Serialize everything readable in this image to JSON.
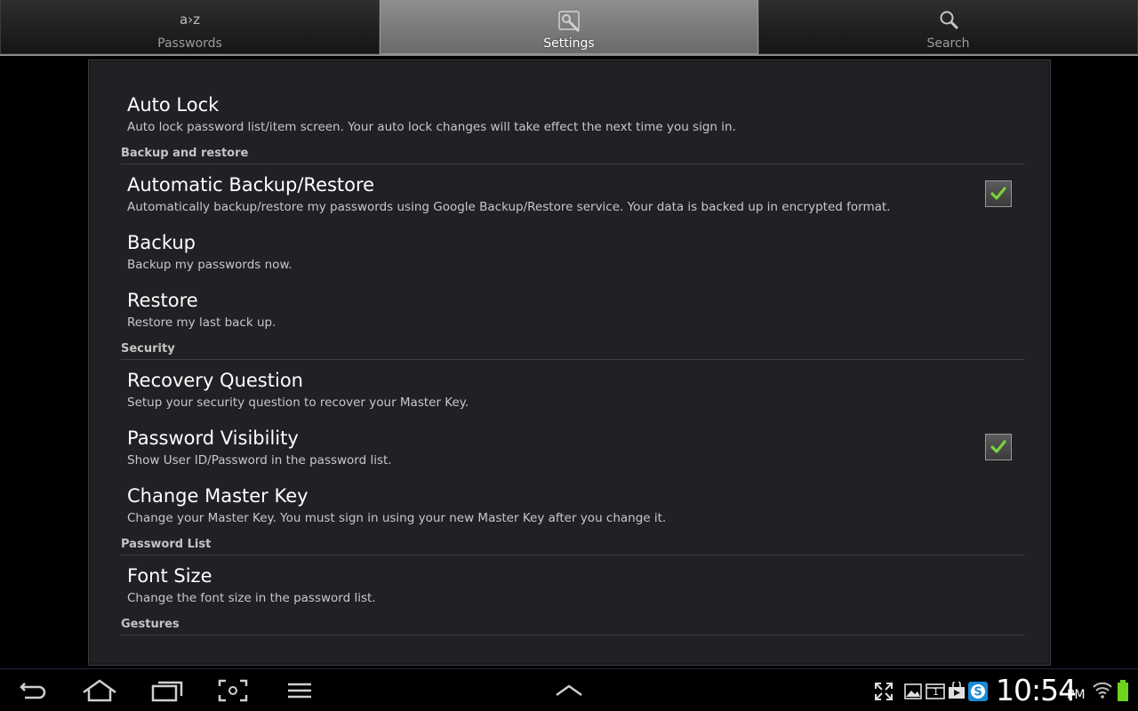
{
  "tabs": [
    {
      "label": "Passwords",
      "icon": "az-icon",
      "icon_text": "a›z"
    },
    {
      "label": "Settings",
      "icon": "tools-icon"
    },
    {
      "label": "Search",
      "icon": "search-icon"
    }
  ],
  "prefs": {
    "auto_lock": {
      "title": "Auto Lock",
      "summary": "Auto lock password list/item screen. Your auto lock changes will take effect the next time you sign in."
    },
    "auto_backup": {
      "title": "Automatic Backup/Restore",
      "summary": "Automatically backup/restore my passwords using Google Backup/Restore service. Your data is backed up in encrypted format.",
      "checked": true
    },
    "backup": {
      "title": "Backup",
      "summary": "Backup my passwords now."
    },
    "restore": {
      "title": "Restore",
      "summary": "Restore my last back up."
    },
    "recovery": {
      "title": "Recovery Question",
      "summary": "Setup your security question to recover your Master Key."
    },
    "visibility": {
      "title": "Password Visibility",
      "summary": "Show User ID/Password in the password list.",
      "checked": true
    },
    "master_key": {
      "title": "Change Master Key",
      "summary": "Change your Master Key. You must sign in using your new Master Key after you change it."
    },
    "font_size": {
      "title": "Font Size",
      "summary": "Change the font size in the password list."
    }
  },
  "categories": {
    "backup": "Backup and restore",
    "security": "Security",
    "password_list": "Password List",
    "gestures": "Gestures"
  },
  "statusbar": {
    "time": "10:54",
    "ampm": "PM",
    "notification_count": "1"
  },
  "colors": {
    "check_green": "#7bd23a",
    "battery_green": "#6fd21e",
    "accent_divider": "#8a8a8a"
  }
}
